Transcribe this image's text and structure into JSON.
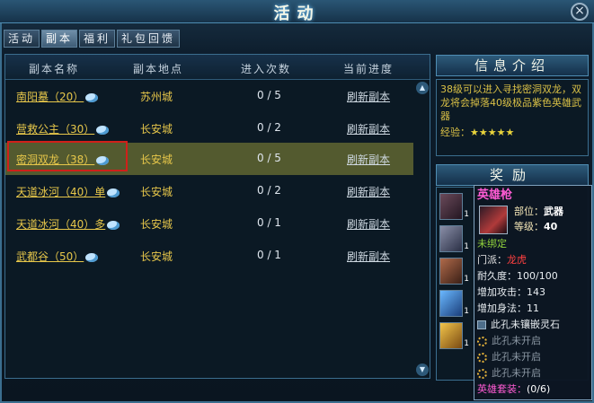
{
  "window": {
    "title": "活动",
    "close_icon": "close-icon"
  },
  "tabs": [
    {
      "label": "活动",
      "active": false
    },
    {
      "label": "副本",
      "active": true
    },
    {
      "label": "福利",
      "active": false
    },
    {
      "label": "礼包回馈",
      "active": false
    }
  ],
  "table": {
    "headers": [
      "副本名称",
      "副本地点",
      "进入次数",
      "当前进度"
    ],
    "rows": [
      {
        "name": "南阳墓（20）",
        "location": "苏州城",
        "count": "0 / 5",
        "action": "刷新副本"
      },
      {
        "name": "营救公主（30）",
        "location": "长安城",
        "count": "0 / 2",
        "action": "刷新副本"
      },
      {
        "name": "密洞双龙（38）",
        "location": "长安城",
        "count": "0 / 5",
        "action": "刷新副本"
      },
      {
        "name": "天道冰河（40）单",
        "location": "长安城",
        "count": "0 / 2",
        "action": "刷新副本"
      },
      {
        "name": "天道冰河（40）多",
        "location": "长安城",
        "count": "0 / 1",
        "action": "刷新副本"
      },
      {
        "name": "武都谷（50）",
        "location": "长安城",
        "count": "0 / 1",
        "action": "刷新副本"
      }
    ],
    "selected_row": 2
  },
  "info": {
    "header": "信息介绍",
    "text": "38级可以进入寻找密洞双龙，双龙将会掉落40级极品紫色英雄武器",
    "exp_label": "经验：",
    "stars": "★★★★★"
  },
  "reward": {
    "header": "奖励",
    "items": [
      {
        "icon": "spear-icon",
        "qty": "1"
      },
      {
        "icon": "claw-icon",
        "qty": "1"
      },
      {
        "icon": "armor-icon",
        "qty": "1"
      },
      {
        "icon": "gem-icon",
        "qty": "1"
      },
      {
        "icon": "scroll-icon",
        "qty": "1"
      }
    ]
  },
  "tooltip": {
    "name": "英雄枪",
    "part_label": "部位：",
    "part_value": "武器",
    "level_label": "等级：",
    "level_value": "40",
    "unbound": "未绑定",
    "faction_label": "门派：",
    "faction_value": "龙虎",
    "durability": "耐久度：100/100",
    "attack": "增加攻击：143",
    "agility": "增加身法：11",
    "socket1": "此孔未镶嵌灵石",
    "socket2": "此孔未开启",
    "socket3": "此孔未开启",
    "socket4": "此孔未开启",
    "suit_label": "英雄套装：",
    "suit_count": "(0/6)"
  },
  "colors": {
    "accent": "#e7c74a",
    "selected_row": "#535a2f",
    "highlight_border": "#d0201a",
    "tooltip_name": "#ff5bd4"
  }
}
